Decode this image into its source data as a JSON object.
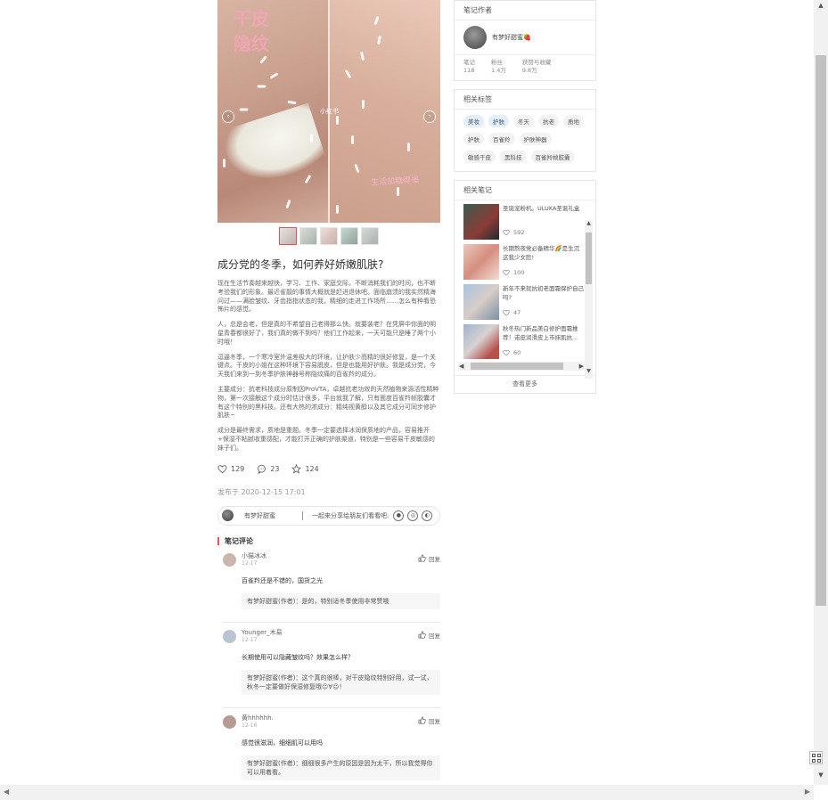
{
  "note": {
    "image_overlay_text": [
      "干皮",
      "隐纹"
    ],
    "image_watermark": "小红书",
    "image_handwriting": "生活加糖得福",
    "title": "成分党的冬季，如何养好娇嫩肌肤?",
    "paragraphs": [
      "现在生活节奏越来越快，学习、工作、家庭交际，不断消耗我们的时间，也不断考验我们的形象。最近雀靓的事情大概就是赶进退休吧。面临崩溃的我实然精海问过——满脸皱纹、牙齿指指状态的我，精细的走进工作场所……怎么有种看恐怖片的感觉。",
      "人，总是会老，但是真的不希望自己老得那么快。就要装老？在凭屏中你面的明星青春都很好了，我们真的做不到吗？他们工作起来，一天可能只是睡了两个小时哦！",
      "逗逼冬季，一个寒冷室外温差极大的环境，让护肤少而精的很好修复，是一个关键点。干皮的小姐在这种环境下容易脱皮，但是也能用好护肤。我是成分党，今天我们来到一到冬季护肤神器号称隐纹痛的百雀羚的成分。",
      "主要成分：抗老科技成分原制因ProVTA，卓越抗老功效的天然植物来源活性精粹物，第一次接触这个成分时估计很多，平台就我了解，只有面度百雀羚帧胶囊才有这个特别的黑科技。还有大热的浓成分：精纯视黄醇以及其它成分可同步修护肌肤~",
      "成分是最终需求，质地是重题。冬季一定要选择冰润保质地的产品，容易推开+保湿不粘腻收重感配，才能打开正确的护肤渠道，特别是一些容易干皮敏感的妹子们。"
    ],
    "likes": "129",
    "comments_count": "23",
    "collects": "124",
    "publish_time": "发布于 2020-12-15 17:01",
    "author_short": "有梦好甜蜜",
    "share_prompt": "一起来分享给朋友们看看吧:"
  },
  "comments": {
    "heading": "笔记评论",
    "reply_label": "回复",
    "items": [
      {
        "user": "小猫冰冰",
        "date": "12-17",
        "text": "百雀羚还是不错的，国货之光",
        "reply": "有梦好甜蜜(作者)：是的，特别适冬季使用非常赞哦"
      },
      {
        "user": "Younger_木易",
        "date": "12-17",
        "text": "长期使用可以隐藏皱纹吗？效果怎么样？",
        "reply": "有梦好甜蜜(作者)：这个真的很棒，对干皮隐纹特别好用，试一试，秋冬一定要做好保湿修复哦☺∀☺！"
      },
      {
        "user": "黄hhhhhh.",
        "date": "12-16",
        "text": "感觉很滋润，细细肌可以用吗",
        "reply": "有梦好甜蜜(作者)：细细很多产生的原因是因为太干，所以我觉得你可以用着看。"
      }
    ]
  },
  "sidebar": {
    "author_card": {
      "heading": "笔记作者",
      "name": "有梦好甜蜜🍓",
      "stats": [
        {
          "label": "笔记",
          "value": "118"
        },
        {
          "label": "粉丝",
          "value": "1.4万"
        },
        {
          "label": "获赞与收藏",
          "value": "9.8万"
        }
      ]
    },
    "tags_card": {
      "heading": "相关标签",
      "tags": [
        {
          "label": "美妆",
          "highlight": true
        },
        {
          "label": "护肤",
          "highlight": true
        },
        {
          "label": "冬天",
          "highlight": false
        },
        {
          "label": "抗老",
          "highlight": false
        },
        {
          "label": "质地",
          "highlight": false
        },
        {
          "label": "护肤",
          "highlight": false
        },
        {
          "label": "百雀羚",
          "highlight": false
        },
        {
          "label": "护肤神器",
          "highlight": false
        },
        {
          "label": "敏感干皮",
          "highlight": false
        },
        {
          "label": "黑科技",
          "highlight": false
        },
        {
          "label": "百雀羚帧胶囊",
          "highlight": false
        }
      ]
    },
    "related_card": {
      "heading": "相关笔记",
      "items": [
        {
          "title": "圣诞宠粉机。ULUKA圣诞礼盒",
          "likes": "592"
        },
        {
          "title": "长期熬夜党必备精华🌈是生沉这我少女脸!",
          "likes": "100"
        },
        {
          "title": "新年不来就抗初老面霜保护自己吗?",
          "likes": "47"
        },
        {
          "title": "秋冬热门新品美白修护面霜推荐！诺皮润滑皮上市抹肌抗...",
          "likes": "60"
        }
      ],
      "see_more": "查看更多"
    }
  }
}
